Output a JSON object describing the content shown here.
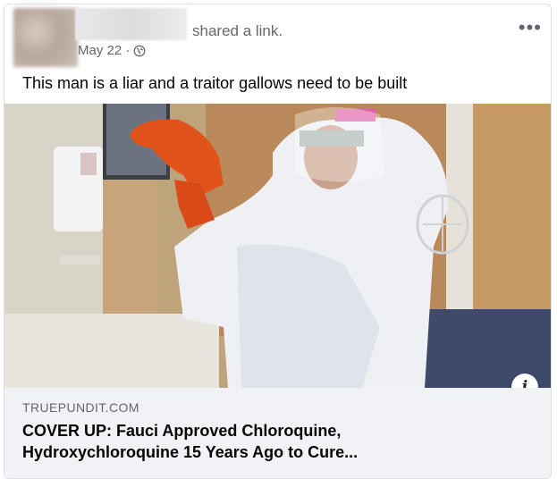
{
  "post": {
    "action_text": "shared a link.",
    "date": "May 22 ·",
    "more_label": "•••",
    "caption": "This man is a liar and a traitor gallows need to be built"
  },
  "link": {
    "domain": "TRUEPUNDIT.COM",
    "headline_line1": "COVER UP: Fauci Approved Chloroquine,",
    "headline_line2": "Hydroxychloroquine 15 Years Ago to Cure...",
    "info_label": "i"
  },
  "icons": {
    "privacy": "globe-icon",
    "more": "more-options-icon",
    "info": "info-icon"
  }
}
